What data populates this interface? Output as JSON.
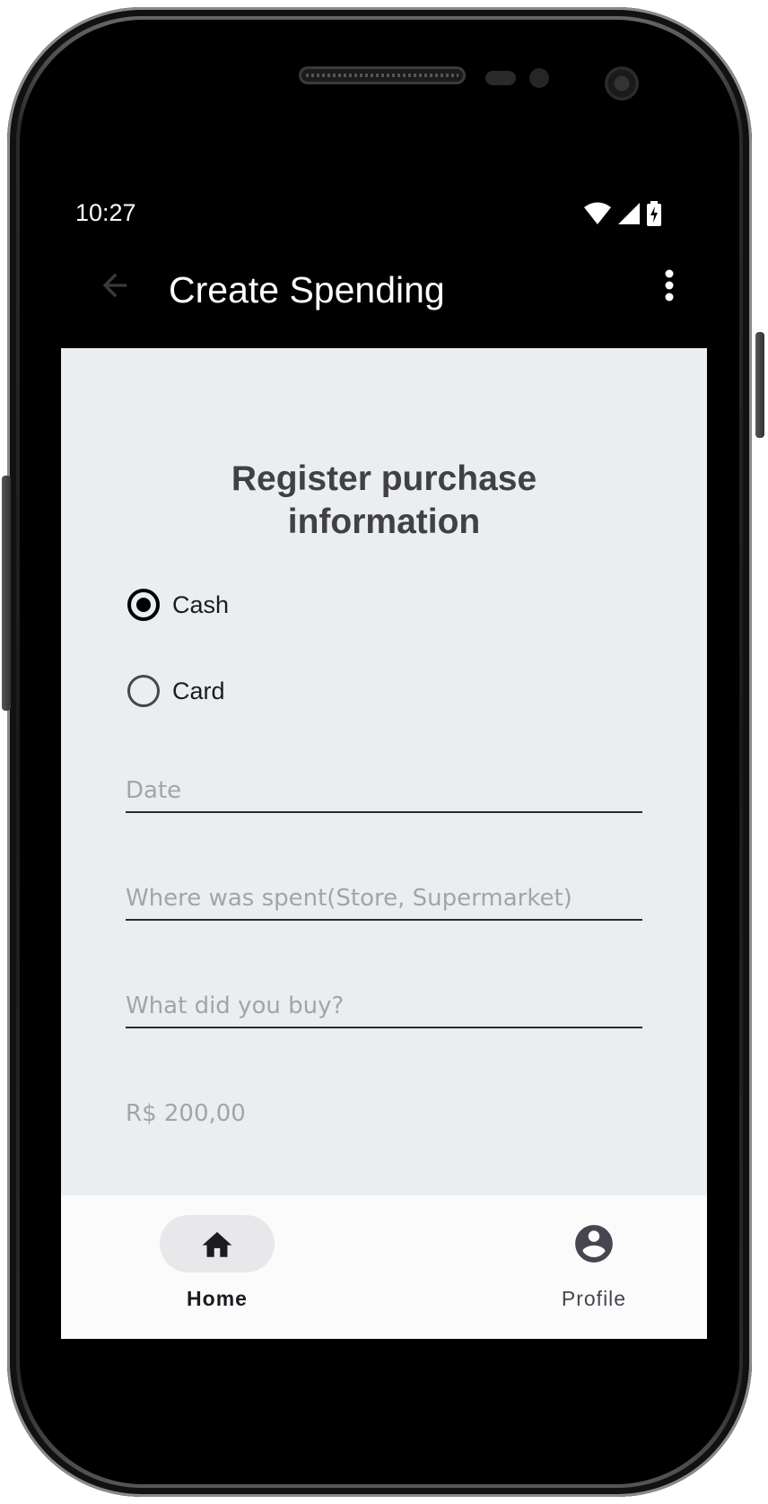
{
  "status_bar": {
    "time": "10:27",
    "icons": [
      "wifi-icon",
      "signal-icon",
      "battery-charging-icon"
    ]
  },
  "app_bar": {
    "title": "Create Spending",
    "back_icon": "arrow-back-icon",
    "menu_icon": "more-vert-icon"
  },
  "form": {
    "heading_line1": "Register purchase",
    "heading_line2": "information",
    "payment_options": [
      {
        "label": "Cash",
        "selected": true
      },
      {
        "label": "Card",
        "selected": false
      }
    ],
    "fields": {
      "date_placeholder": "Date",
      "where_placeholder": "Where was spent(Store, Supermarket)",
      "what_placeholder": "What did you buy?",
      "amount_placeholder": "R$ 200,00"
    }
  },
  "bottom_nav": {
    "items": [
      {
        "label": "Home",
        "icon": "home-icon",
        "active": true
      },
      {
        "label": "Profile",
        "icon": "account-circle-icon",
        "active": false
      }
    ]
  },
  "colors": {
    "background": "#ebeef1",
    "heading": "#414047",
    "placeholder": "#a3a4a8",
    "appbar": "#000000",
    "nav_background": "#fbfbfc"
  }
}
